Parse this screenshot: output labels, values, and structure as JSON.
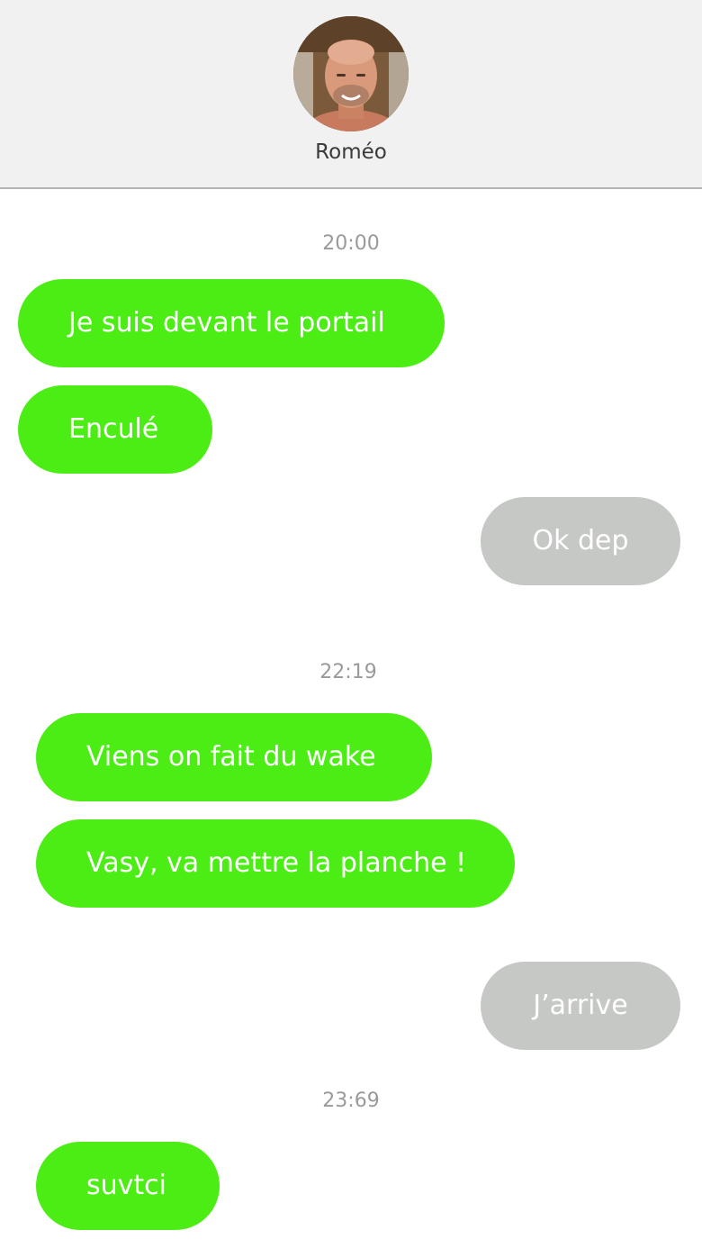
{
  "header": {
    "contact_name": "Roméo",
    "avatar_icon": "contact-avatar-photo"
  },
  "colors": {
    "incoming_bubble": "#4ced15",
    "outgoing_bubble": "#c6c8c5",
    "header_bg": "#f1f1f1",
    "timestamp_text": "#9a9a9a"
  },
  "conversation": {
    "timestamp_1": "20:00",
    "timestamp_2": "22:19",
    "timestamp_3": "23:69",
    "messages": [
      {
        "direction": "incoming",
        "text": "Je suis devant le portail"
      },
      {
        "direction": "incoming",
        "text": "Enculé"
      },
      {
        "direction": "outgoing",
        "text": "Ok dep"
      },
      {
        "direction": "incoming",
        "text": "Viens on fait du wake"
      },
      {
        "direction": "incoming",
        "text": "Vasy, va mettre la planche !"
      },
      {
        "direction": "outgoing",
        "text": "J’arrive"
      },
      {
        "direction": "incoming",
        "text": "suvtci"
      }
    ]
  }
}
